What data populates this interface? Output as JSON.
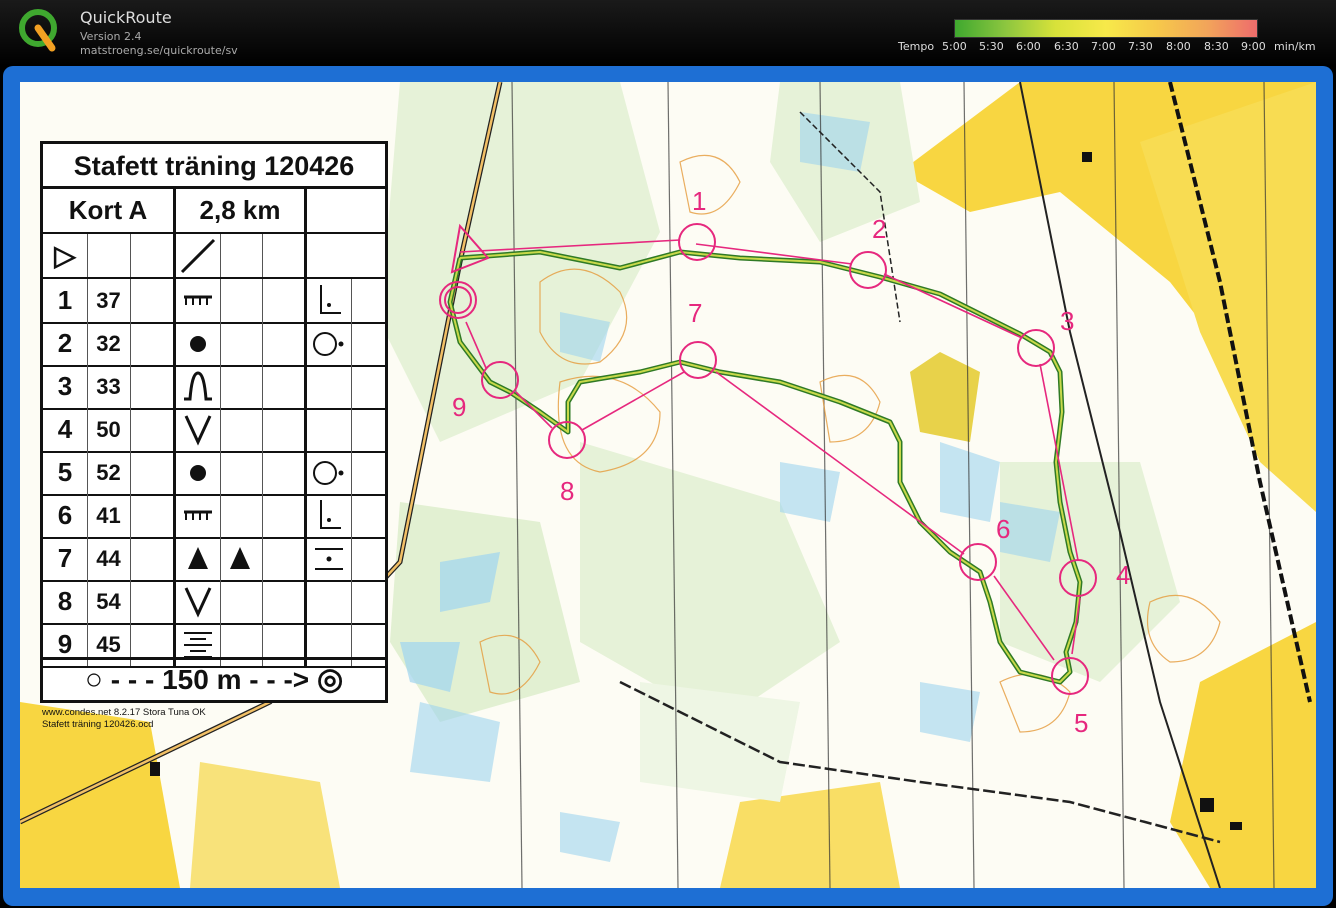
{
  "app": {
    "name": "QuickRoute",
    "version": "Version 2.4",
    "url": "matstroeng.se/quickroute/sv"
  },
  "tempo_scale": {
    "label": "Tempo",
    "ticks": [
      "5:00",
      "5:30",
      "6:00",
      "6:30",
      "7:00",
      "7:30",
      "8:00",
      "8:30",
      "9:00"
    ],
    "unit": "min/km",
    "colors": [
      "#3fa82f",
      "#8cc63f",
      "#d8e23a",
      "#f7e94a",
      "#f6c94a",
      "#f2a55a",
      "#ee6c6c"
    ]
  },
  "legend": {
    "title": "Stafett träning 120426",
    "course": "Kort A",
    "length": "2,8 km",
    "start_symbol": "▷",
    "controls": [
      {
        "num": "1",
        "code": "37",
        "feature": "ditch-end",
        "detail": "corner-se"
      },
      {
        "num": "2",
        "code": "32",
        "feature": "boulder",
        "detail": "east-side"
      },
      {
        "num": "3",
        "code": "33",
        "feature": "knoll",
        "detail": ""
      },
      {
        "num": "4",
        "code": "50",
        "feature": "reentrant",
        "detail": ""
      },
      {
        "num": "5",
        "code": "52",
        "feature": "boulder",
        "detail": "east-side"
      },
      {
        "num": "6",
        "code": "41",
        "feature": "ditch-end",
        "detail": "corner-se"
      },
      {
        "num": "7",
        "code": "44",
        "feature": "two-boulders",
        "detail": "between"
      },
      {
        "num": "8",
        "code": "54",
        "feature": "reentrant",
        "detail": ""
      },
      {
        "num": "9",
        "code": "45",
        "feature": "marsh",
        "detail": ""
      }
    ],
    "finish_text": "150 m",
    "credit_line1": "www.condes.net 8.2.17 Stora Tuna OK",
    "credit_line2": "Stafett träning 120426.ocd"
  },
  "course": {
    "control_numbers": [
      "1",
      "2",
      "3",
      "4",
      "5",
      "6",
      "7",
      "8",
      "9"
    ],
    "color": "#e6287e",
    "route_color": "#3c8a2a"
  }
}
